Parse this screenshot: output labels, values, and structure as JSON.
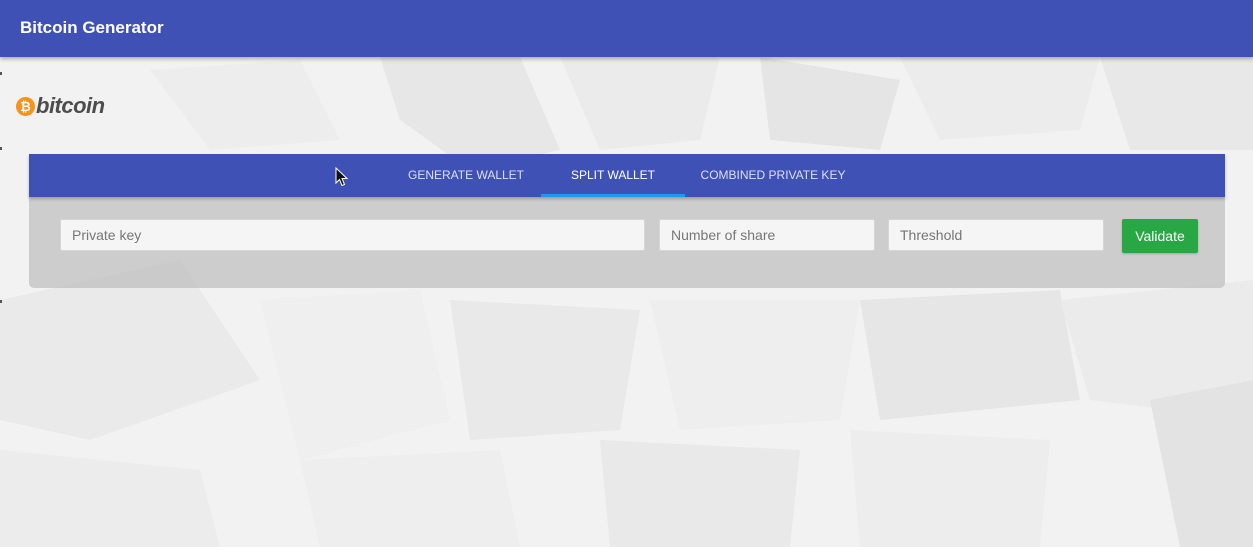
{
  "app_bar": {
    "title": "Bitcoin Generator",
    "color": "#3f51b5"
  },
  "logo": {
    "coin_symbol": "₿",
    "text": "bitcoin",
    "coin_color": "#f7931a"
  },
  "tabs": [
    {
      "label": "GENERATE WALLET",
      "active": false
    },
    {
      "label": "SPLIT WALLET",
      "active": true
    },
    {
      "label": "COMBINED PRIVATE KEY",
      "active": false
    }
  ],
  "form": {
    "private_key": {
      "placeholder": "Private key",
      "value": ""
    },
    "number_of_share": {
      "placeholder": "Number of share",
      "value": ""
    },
    "threshold": {
      "placeholder": "Threshold",
      "value": ""
    },
    "validate_label": "Validate"
  },
  "colors": {
    "accent": "#3f51b5",
    "tab_indicator": "#2196f3",
    "success": "#28a745"
  },
  "icons": {
    "cursor": "mouse-pointer-icon"
  }
}
